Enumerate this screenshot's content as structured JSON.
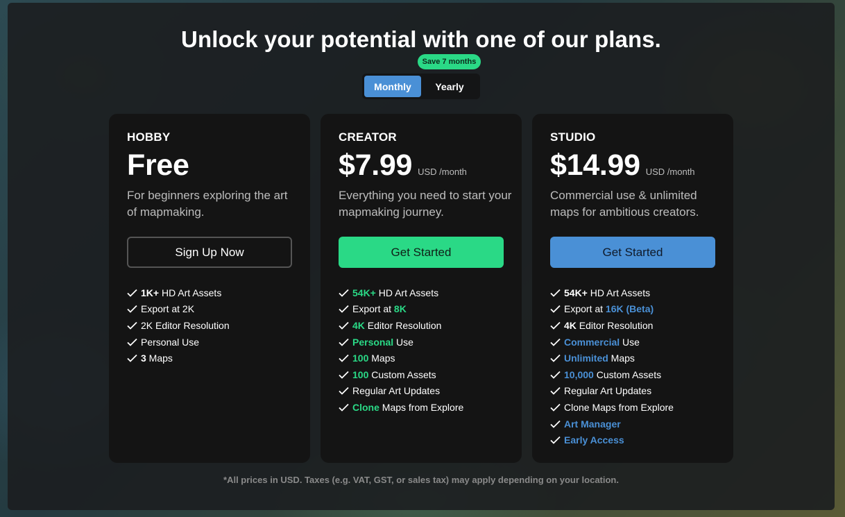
{
  "headline": "Unlock your potential with one of our plans.",
  "billing": {
    "badge": "Save 7 months",
    "monthly_label": "Monthly",
    "yearly_label": "Yearly",
    "selected": "Monthly"
  },
  "plans": [
    {
      "name": "HOBBY",
      "price": "Free",
      "period": "",
      "description": "For beginners exploring the art of mapmaking.",
      "cta": "Sign Up Now",
      "features": [
        [
          {
            "t": "1K+",
            "s": "white"
          },
          {
            "t": " HD Art Assets"
          }
        ],
        [
          {
            "t": "Export at 2K"
          }
        ],
        [
          {
            "t": "2K Editor Resolution"
          }
        ],
        [
          {
            "t": "Personal Use"
          }
        ],
        [
          {
            "t": "3",
            "s": "white"
          },
          {
            "t": " Maps"
          }
        ]
      ]
    },
    {
      "name": "CREATOR",
      "price": "$7.99",
      "period": "USD /month",
      "description": "Everything you need to start your mapmaking journey.",
      "cta": "Get Started",
      "features": [
        [
          {
            "t": "54K+",
            "s": "green"
          },
          {
            "t": " HD Art Assets"
          }
        ],
        [
          {
            "t": "Export at "
          },
          {
            "t": "8K",
            "s": "green"
          }
        ],
        [
          {
            "t": "4K",
            "s": "green"
          },
          {
            "t": " Editor Resolution"
          }
        ],
        [
          {
            "t": "Personal",
            "s": "green"
          },
          {
            "t": " Use"
          }
        ],
        [
          {
            "t": "100",
            "s": "green"
          },
          {
            "t": " Maps"
          }
        ],
        [
          {
            "t": "100",
            "s": "green"
          },
          {
            "t": " Custom Assets"
          }
        ],
        [
          {
            "t": "Regular Art Updates"
          }
        ],
        [
          {
            "t": "Clone",
            "s": "green"
          },
          {
            "t": " Maps from Explore"
          }
        ]
      ]
    },
    {
      "name": "STUDIO",
      "price": "$14.99",
      "period": "USD /month",
      "description": "Commercial use & unlimited maps for ambitious creators.",
      "cta": "Get Started",
      "features": [
        [
          {
            "t": "54K+",
            "s": "white"
          },
          {
            "t": " HD Art Assets"
          }
        ],
        [
          {
            "t": "Export at "
          },
          {
            "t": "16K (Beta)",
            "s": "blue"
          }
        ],
        [
          {
            "t": "4K",
            "s": "white"
          },
          {
            "t": " Editor Resolution"
          }
        ],
        [
          {
            "t": "Commercial",
            "s": "blue"
          },
          {
            "t": " Use"
          }
        ],
        [
          {
            "t": "Unlimited",
            "s": "blue"
          },
          {
            "t": " Maps"
          }
        ],
        [
          {
            "t": "10,000",
            "s": "blue"
          },
          {
            "t": " Custom Assets"
          }
        ],
        [
          {
            "t": "Regular Art Updates"
          }
        ],
        [
          {
            "t": "Clone Maps from Explore"
          }
        ],
        [
          {
            "t": "Art Manager",
            "s": "blue"
          }
        ],
        [
          {
            "t": "Early Access",
            "s": "blue"
          }
        ]
      ]
    }
  ],
  "footnote": "*All prices in USD. Taxes (e.g. VAT, GST, or sales tax) may apply depending on your location.",
  "colors": {
    "accent_green": "#2ad986",
    "accent_blue": "#4a90d6",
    "card_bg": "#141414"
  },
  "icons": {
    "feature_bullet": "check-icon"
  }
}
